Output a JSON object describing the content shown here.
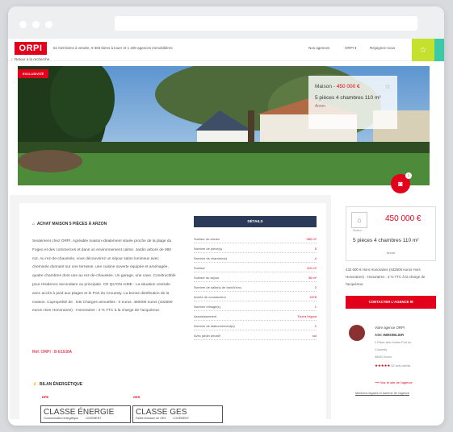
{
  "header": {
    "logo": "ORPI",
    "tagline": "51 019 biens à vendre, 9 383 biens à louer et 1 200 agences immobilières",
    "links": [
      "Nos agences",
      "ORPI ▾",
      "Rejoignez-nous"
    ],
    "back": "Retour à la recherche"
  },
  "hero": {
    "badge": "EXCLUSIVITÉ",
    "type_label": "Maison - ",
    "price": "450 000 €",
    "rooms_line": "5 pièces 4 chambres 110 m²",
    "city": "Arzon",
    "photo_count": "1"
  },
  "main": {
    "title": "ACHAT MAISON 5 PIÈCES À ARZON",
    "description": "Seulement chez ORPI. Agréable maison idéalement située proche de la plage du Fogeo et des commerces et dans un environnement calme. Jardin arboré de 980 m2. Au rez-de-chaussée, vous découvrirez un séjour salon lumineux avec cheminée donnant sur une terrasse, une cuisine ouverte équipée et aménagée, quatre chambres dont une au rez-de-chaussée. Un garage, une cave. Constructible pour résidence secondaire ou principale. CE QU'ON AIME : La situation centrale avec accès à pied aux plages et le Port du Crouesty. La bonne distribution de la maison. Copropriété de . lots Charges annuelles : 0 euros. 450000 euros (432600 euros Hors Honoraires) - Honoraires : 4 % TTC à la charge de l'acquéreur.",
    "ref": "Réf. ORPI : B-E1E9IA",
    "energy_title": "BILAN ÉNERGÉTIQUE",
    "dpe_label": "DPE",
    "ges_label": "GES",
    "class_energie": "CLASSE ÉNERGIE",
    "class_energie_sub": "Consommation énergétique",
    "class_ges": "CLASSE GES",
    "class_ges_sub": "Faible émission de GES",
    "locaux": "LOGEMENT"
  },
  "details": {
    "header": "DÉTAILS",
    "rows": [
      {
        "k": "Surface du terrain",
        "v": "980 m²"
      },
      {
        "k": "Nombre de pièce(s)",
        "v": "5"
      },
      {
        "k": "Nombre de chambre(s)",
        "v": "4"
      },
      {
        "k": "Surface",
        "v": "110 m²"
      },
      {
        "k": "Surface du séjour",
        "v": "36 m²"
      },
      {
        "k": "Nombre de salle(s) de bain/d'eau",
        "v": "2"
      },
      {
        "k": "Année de construction",
        "v": "1978"
      },
      {
        "k": "Nombre d'étage(s)",
        "v": "1"
      },
      {
        "k": "Assainissement",
        "v": "Tout à l'égout"
      },
      {
        "k": "Nombre de stationnement(s)",
        "v": "1"
      },
      {
        "k": "Avec jardin privatif",
        "v": "oui"
      }
    ]
  },
  "sidebar": {
    "house_caption": "Maison",
    "price": "450 000 €",
    "rooms_line": "5 pièces 4 chambres 110 m²",
    "city": "Arzon",
    "fees": "432 600 € Hors Honoraires (432600 euros Hors Honoraires) - Honoraires : 4 % TTC à la charge de l'acquéreur.",
    "contact": "CONTACTER L'AGENCE ✉",
    "agency_label": "Votre agence ORPI",
    "agency_name": "ASC IMMOBILIER",
    "agency_addr1": "2 Place des Hortes Port du",
    "agency_addr2": "Crouesty",
    "agency_addr3": "56640 Arzon",
    "rating": "★★★★★",
    "reviews": "62 avis clients",
    "site_link": "⟶  Voir le site de l'agence",
    "legal": "Mentions légales et barème de l'agence"
  },
  "colors": {
    "brand": "#e2001a",
    "navy": "#2c3a5a"
  }
}
